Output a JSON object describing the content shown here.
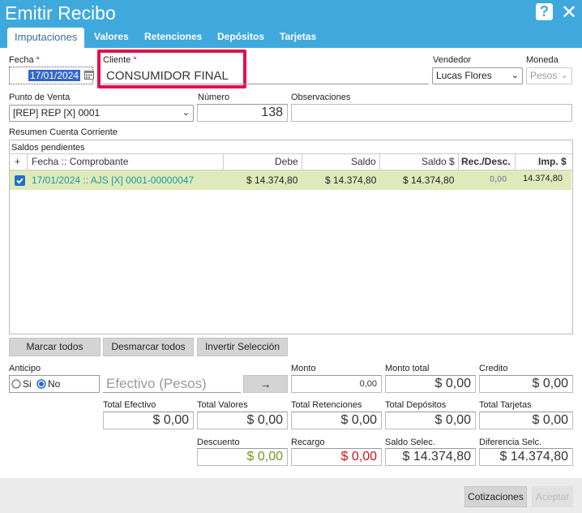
{
  "window": {
    "title": "Emitir Recibo",
    "help_label": "?",
    "close_label": "✕"
  },
  "tabs": [
    "Imputaciones",
    "Valores",
    "Retenciones",
    "Depósitos",
    "Tarjetas"
  ],
  "header": {
    "fecha_label": "Fecha",
    "required_mark": "*",
    "fecha_value": "17/01/2024",
    "cliente_label": "Cliente",
    "cliente_value": "CONSUMIDOR FINAL",
    "vendedor_label": "Vendedor",
    "vendedor_value": "Lucas Flores",
    "moneda_label": "Moneda",
    "moneda_value": "Pesos",
    "punto_label": "Punto de Venta",
    "punto_value": "[REP] REP [X] 0001",
    "numero_label": "Número",
    "numero_value": "138",
    "obs_label": "Observaciones",
    "obs_value": ""
  },
  "resumen_label": "Resumen Cuenta Corriente",
  "saldos_label": "Saldos pendientes",
  "table": {
    "headers": {
      "plus": "+",
      "fecha": "Fecha :: Comprobante",
      "debe": "Debe",
      "saldo": "Saldo",
      "saldo_s": "Saldo $",
      "rec": "Rec./Desc.",
      "imp": "Imp. $"
    },
    "rows": [
      {
        "comprobante": "17/01/2024 :: AJS [X] 0001-00000047",
        "debe": "$ 14.374,80",
        "saldo": "$ 14.374,80",
        "saldo_s": "$ 14.374,80",
        "rec": "0,00",
        "imp": "14.374,80",
        "checked": true
      }
    ]
  },
  "buttons": {
    "marcar": "Marcar todos",
    "desmarcar": "Desmarcar todos",
    "invertir": "Invertir Selección",
    "arrow": "→",
    "cotizaciones": "Cotizaciones",
    "aceptar": "Aceptar"
  },
  "anticipo": {
    "label": "Anticipo",
    "si": "Si",
    "no": "No",
    "selected": "No",
    "efectivo_placeholder": "Efectivo (Pesos)"
  },
  "monto": {
    "label": "Monto",
    "value": "0,00"
  },
  "totals": [
    {
      "label": "Monto total",
      "value": "$ 0,00"
    },
    {
      "label": "Credito",
      "value": "$ 0,00"
    },
    {
      "label": "Total Efectivo",
      "value": "$ 0,00"
    },
    {
      "label": "Total Valores",
      "value": "$ 0,00"
    },
    {
      "label": "Total Retenciones",
      "value": "$ 0,00"
    },
    {
      "label": "Total Depósitos",
      "value": "$ 0,00"
    },
    {
      "label": "Total Tarjetas",
      "value": "$ 0,00"
    },
    {
      "label": "Descuento",
      "value": "$ 0,00"
    },
    {
      "label": "Recargo",
      "value": "$ 0,00"
    },
    {
      "label": "Saldo Selec.",
      "value": "$ 14.374,80"
    },
    {
      "label": "Diferencia Selc.",
      "value": "$ 14.374,80"
    }
  ],
  "colors": {
    "titlebar": "#3fa9dd",
    "highlight": "#e0114b",
    "row_bg": "#dfeabb",
    "row_text": "#1a9aa0",
    "descuento": "#6c9a1c",
    "recargo": "#d41414"
  }
}
